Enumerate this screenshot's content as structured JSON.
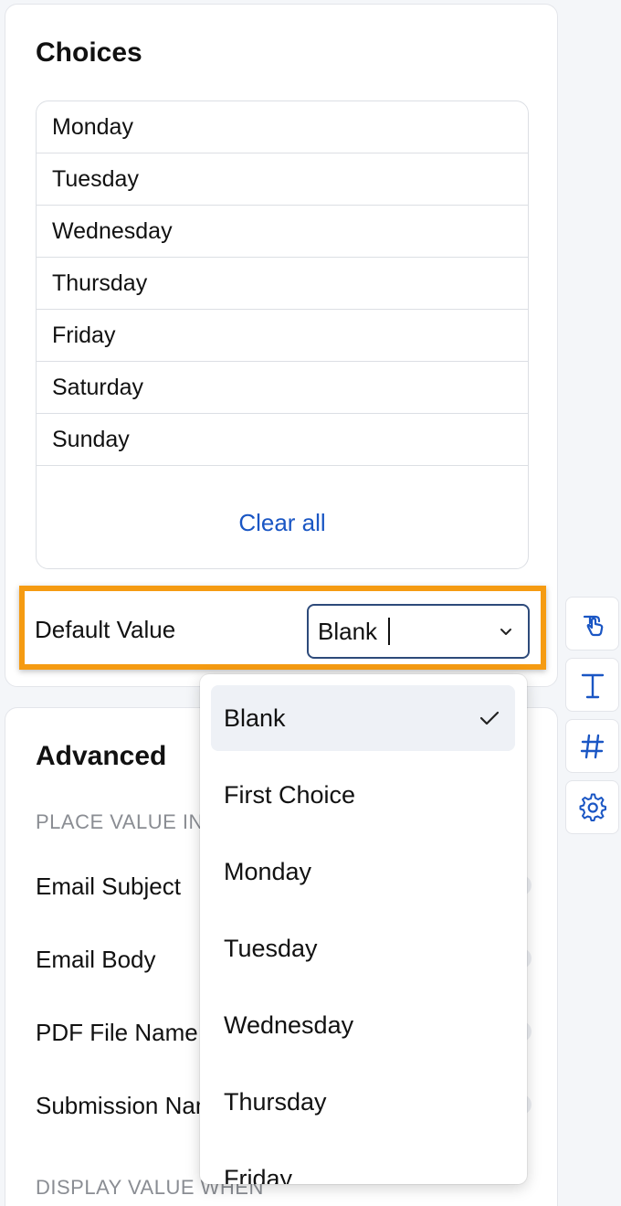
{
  "choices": {
    "title": "Choices",
    "items": [
      "Monday",
      "Tuesday",
      "Wednesday",
      "Thursday",
      "Friday",
      "Saturday",
      "Sunday"
    ],
    "clear_all": "Clear all"
  },
  "default_value": {
    "label": "Default Value",
    "selected": "Blank"
  },
  "dropdown": {
    "options": [
      "Blank",
      "First Choice",
      "Monday",
      "Tuesday",
      "Wednesday",
      "Thursday",
      "Friday"
    ],
    "selected_option": "Blank"
  },
  "advanced": {
    "title": "Advanced",
    "place_value_heading": "PLACE VALUE IN",
    "rows": [
      "Email Subject",
      "Email Body",
      "PDF File Name",
      "Submission Name"
    ],
    "display_value_heading": "DISPLAY VALUE WHEN"
  },
  "side_tools": [
    "pointer-hand-icon",
    "text-icon",
    "hash-icon",
    "gear-icon"
  ],
  "colors": {
    "accent": "#1a56c4",
    "highlight": "#f59b12",
    "select_border": "#2d4a7a"
  }
}
